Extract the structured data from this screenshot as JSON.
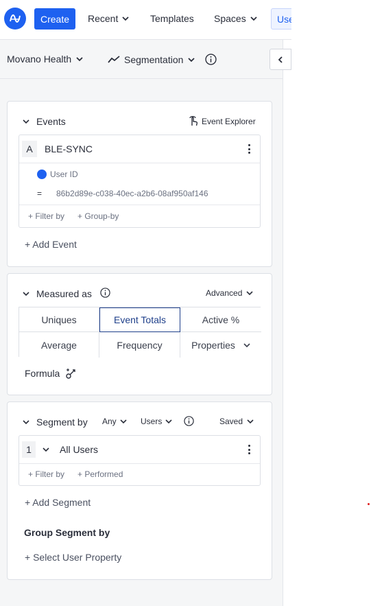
{
  "topbar": {
    "create_label": "Create",
    "recent_label": "Recent",
    "templates_label": "Templates",
    "spaces_label": "Spaces",
    "users_label": "Users"
  },
  "subheader": {
    "project": "Movano Health",
    "chart_type": "Segmentation"
  },
  "events": {
    "title": "Events",
    "explorer_label": "Event Explorer",
    "event_letter": "A",
    "event_name": "BLE-SYNC",
    "property_label": "User ID",
    "operator": "=",
    "property_value": "86b2d89e-c038-40ec-a2b6-08af950af146",
    "filter_label": "+ Filter by",
    "group_label": "+ Group-by",
    "add_event_label": "+ Add Event"
  },
  "measured": {
    "title": "Measured as",
    "advanced_label": "Advanced",
    "options": [
      "Uniques",
      "Event Totals",
      "Active %",
      "Average",
      "Frequency",
      "Properties"
    ],
    "selected": "Event Totals",
    "formula_label": "Formula"
  },
  "segment": {
    "title": "Segment by",
    "any_label": "Any",
    "users_label": "Users",
    "saved_label": "Saved",
    "segment_number": "1",
    "segment_name": "All Users",
    "filter_label": "+ Filter by",
    "performed_label": "+ Performed",
    "add_segment_label": "+ Add Segment",
    "group_segment_title": "Group Segment by",
    "select_property_label": "+ Select User Property"
  },
  "colors": {
    "brand": "#1e61f0",
    "selected_border": "#1e3f8a",
    "panel_bg": "#f5f6f7"
  }
}
